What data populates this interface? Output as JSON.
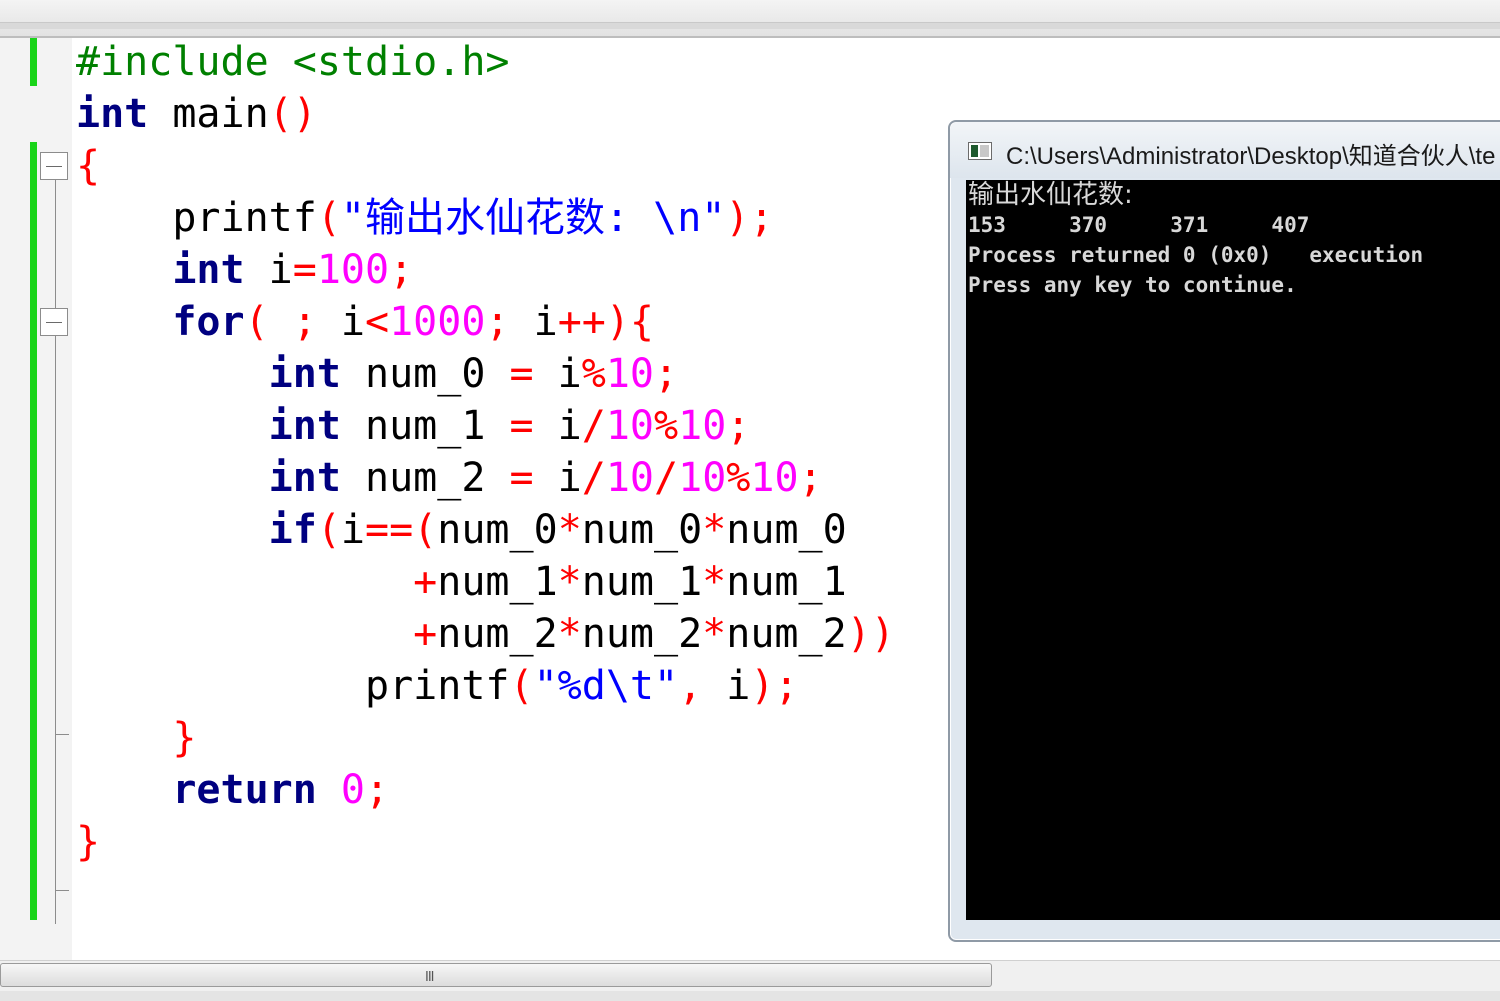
{
  "editor": {
    "language": "C",
    "lines": [
      [
        {
          "c": "pp",
          "t": "#include <stdio.h>"
        }
      ],
      [
        {
          "c": "kw",
          "t": "int"
        },
        {
          "c": "id",
          "t": " main"
        },
        {
          "c": "op",
          "t": "()"
        }
      ],
      [
        {
          "c": "op",
          "t": "{"
        }
      ],
      [
        {
          "c": "id",
          "t": "    printf"
        },
        {
          "c": "op",
          "t": "("
        },
        {
          "c": "str",
          "t": "\"输出水仙花数: \\n\""
        },
        {
          "c": "op",
          "t": ");"
        }
      ],
      [
        {
          "c": "kw",
          "t": "    int"
        },
        {
          "c": "id",
          "t": " i"
        },
        {
          "c": "op",
          "t": "="
        },
        {
          "c": "num",
          "t": "100"
        },
        {
          "c": "op",
          "t": ";"
        }
      ],
      [
        {
          "c": "kw",
          "t": "    for"
        },
        {
          "c": "op",
          "t": "( ; "
        },
        {
          "c": "id",
          "t": "i"
        },
        {
          "c": "op",
          "t": "<"
        },
        {
          "c": "num",
          "t": "1000"
        },
        {
          "c": "op",
          "t": "; "
        },
        {
          "c": "id",
          "t": "i"
        },
        {
          "c": "op",
          "t": "++){"
        }
      ],
      [
        {
          "c": "kw",
          "t": "        int"
        },
        {
          "c": "id",
          "t": " num_0 "
        },
        {
          "c": "op",
          "t": "= "
        },
        {
          "c": "id",
          "t": "i"
        },
        {
          "c": "op",
          "t": "%"
        },
        {
          "c": "num",
          "t": "10"
        },
        {
          "c": "op",
          "t": ";"
        }
      ],
      [
        {
          "c": "kw",
          "t": "        int"
        },
        {
          "c": "id",
          "t": " num_1 "
        },
        {
          "c": "op",
          "t": "= "
        },
        {
          "c": "id",
          "t": "i"
        },
        {
          "c": "op",
          "t": "/"
        },
        {
          "c": "num",
          "t": "10"
        },
        {
          "c": "op",
          "t": "%"
        },
        {
          "c": "num",
          "t": "10"
        },
        {
          "c": "op",
          "t": ";"
        }
      ],
      [
        {
          "c": "kw",
          "t": "        int"
        },
        {
          "c": "id",
          "t": " num_2 "
        },
        {
          "c": "op",
          "t": "= "
        },
        {
          "c": "id",
          "t": "i"
        },
        {
          "c": "op",
          "t": "/"
        },
        {
          "c": "num",
          "t": "10"
        },
        {
          "c": "op",
          "t": "/"
        },
        {
          "c": "num",
          "t": "10"
        },
        {
          "c": "op",
          "t": "%"
        },
        {
          "c": "num",
          "t": "10"
        },
        {
          "c": "op",
          "t": ";"
        }
      ],
      [
        {
          "c": "kw",
          "t": "        if"
        },
        {
          "c": "op",
          "t": "("
        },
        {
          "c": "id",
          "t": "i"
        },
        {
          "c": "op",
          "t": "==("
        },
        {
          "c": "id",
          "t": "num_0"
        },
        {
          "c": "op",
          "t": "*"
        },
        {
          "c": "id",
          "t": "num_0"
        },
        {
          "c": "op",
          "t": "*"
        },
        {
          "c": "id",
          "t": "num_0"
        }
      ],
      [
        {
          "c": "op",
          "t": "              +"
        },
        {
          "c": "id",
          "t": "num_1"
        },
        {
          "c": "op",
          "t": "*"
        },
        {
          "c": "id",
          "t": "num_1"
        },
        {
          "c": "op",
          "t": "*"
        },
        {
          "c": "id",
          "t": "num_1"
        }
      ],
      [
        {
          "c": "op",
          "t": "              +"
        },
        {
          "c": "id",
          "t": "num_2"
        },
        {
          "c": "op",
          "t": "*"
        },
        {
          "c": "id",
          "t": "num_2"
        },
        {
          "c": "op",
          "t": "*"
        },
        {
          "c": "id",
          "t": "num_2"
        },
        {
          "c": "op",
          "t": "))"
        }
      ],
      [
        {
          "c": "id",
          "t": "            printf"
        },
        {
          "c": "op",
          "t": "("
        },
        {
          "c": "str",
          "t": "\"%d\\t\""
        },
        {
          "c": "op",
          "t": ", "
        },
        {
          "c": "id",
          "t": "i"
        },
        {
          "c": "op",
          "t": ");"
        }
      ],
      [
        {
          "c": "op",
          "t": "    }"
        }
      ],
      [
        {
          "c": "kw",
          "t": "    return"
        },
        {
          "c": "id",
          "t": " "
        },
        {
          "c": "num",
          "t": "0"
        },
        {
          "c": "op",
          "t": ";"
        }
      ],
      [
        {
          "c": "op",
          "t": "}"
        }
      ]
    ]
  },
  "console": {
    "title": "C:\\Users\\Administrator\\Desktop\\知道合伙人\\te",
    "output_heading": "输出水仙花数:",
    "output_values": "153     370     371     407",
    "process_line": "Process returned 0 (0x0)   execution",
    "press_line": "Press any key to continue."
  },
  "scrollbar": {
    "grip_glyph": "III"
  },
  "colors": {
    "change_bar": "#19d419",
    "keyword": "#000080",
    "preprocessor": "#008000",
    "operator": "#ff0000",
    "number": "#ff00ff",
    "string": "#0000ff",
    "console_bg": "#000000"
  }
}
